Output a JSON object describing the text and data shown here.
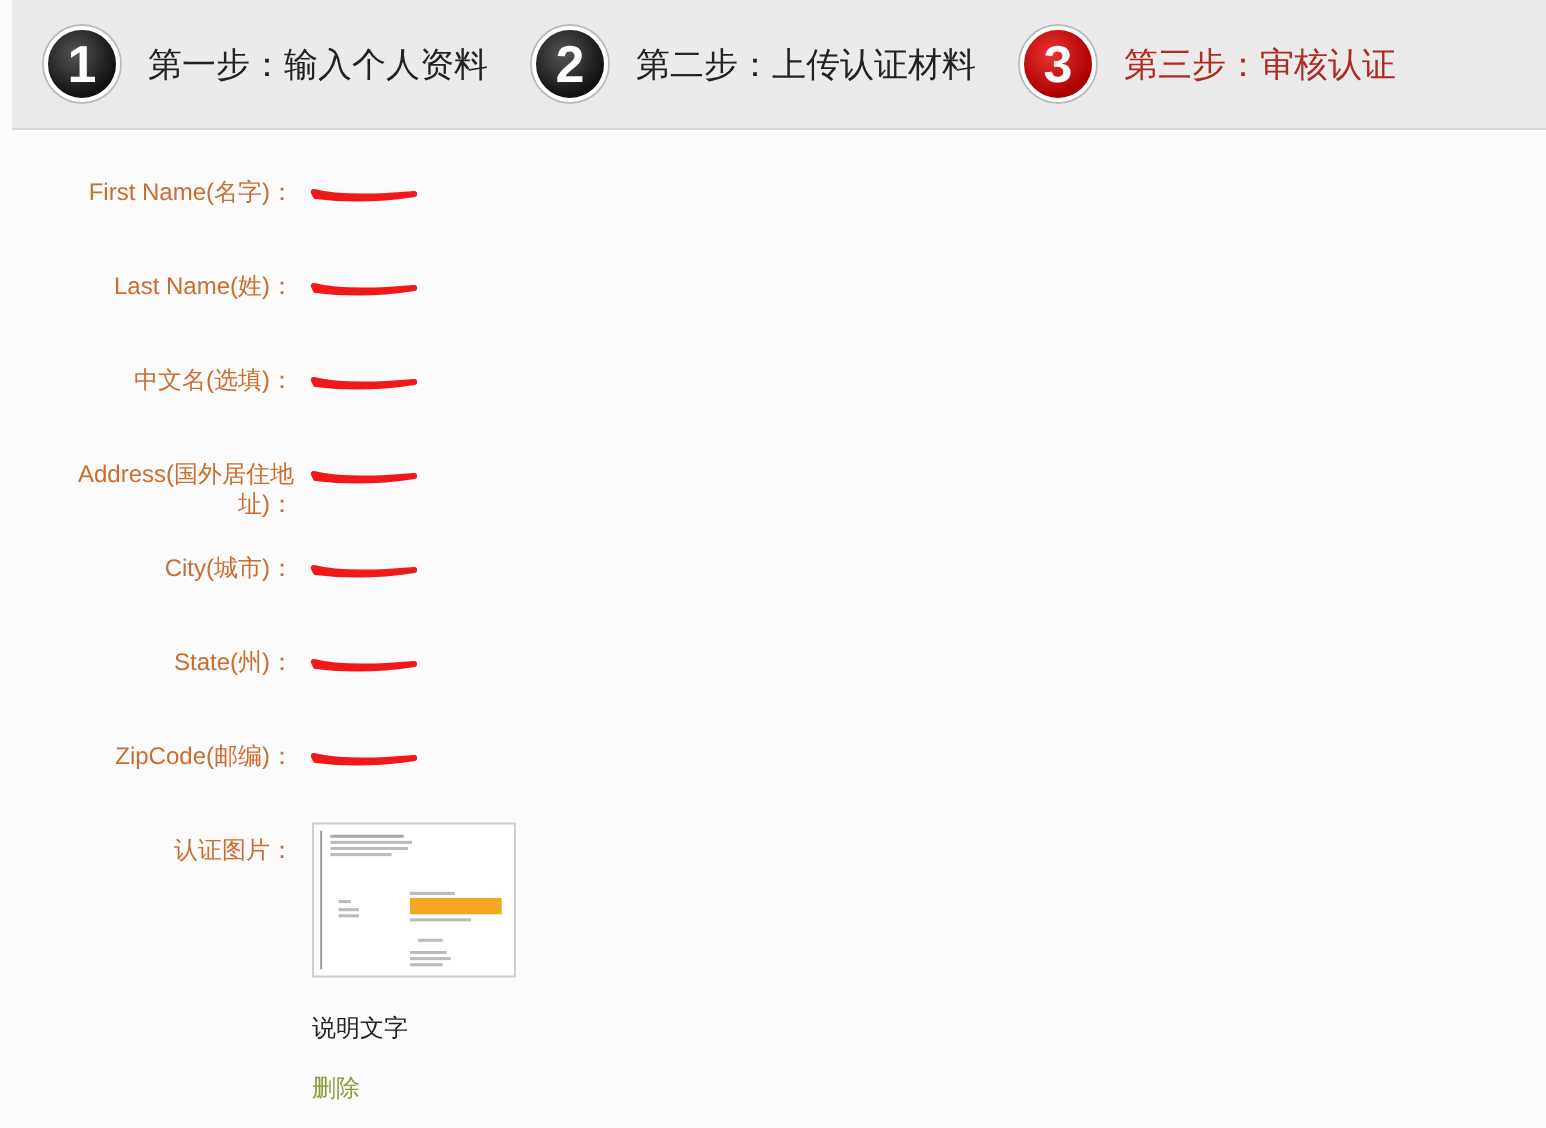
{
  "steps": [
    {
      "number": "1",
      "label": "第一步：输入个人资料",
      "selected": false
    },
    {
      "number": "2",
      "label": "第二步：上传认证材料",
      "selected": false
    },
    {
      "number": "3",
      "label": "第三步：审核认证",
      "selected": true
    }
  ],
  "fields": [
    {
      "label": "First Name(名字)：",
      "redacted": true
    },
    {
      "label": "Last Name(姓)：",
      "redacted": true
    },
    {
      "label": "中文名(选填)：",
      "redacted": true
    },
    {
      "label": "Address(国外居住地址)：",
      "redacted": true
    },
    {
      "label": "City(城市)：",
      "redacted": true
    },
    {
      "label": "State(州)：",
      "redacted": true
    },
    {
      "label": "ZipCode(邮编)：",
      "redacted": true
    }
  ],
  "photo": {
    "label": "认证图片：",
    "caption": "说明文字",
    "delete": "删除"
  }
}
